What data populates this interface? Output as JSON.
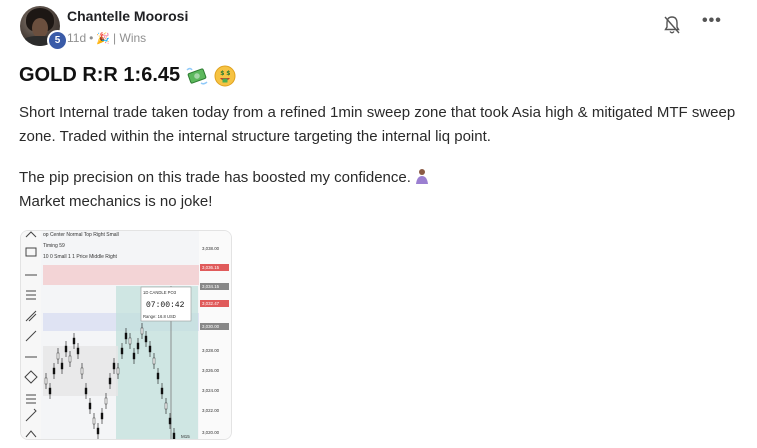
{
  "post": {
    "author": "Chantelle Moorosi",
    "level": "5",
    "time_ago": "11d",
    "separator": "•",
    "category": "| Wins",
    "title": "GOLD R:R 1:6.45",
    "title_emojis": [
      "money-with-wings-icon",
      "money-mouth-face-icon"
    ],
    "paragraph1": "Short Internal trade taken today from a refined 1min sweep zone that took Asia high & mitigated MTF sweep zone. Traded within the internal structure targeting the internal liq point.",
    "paragraph2_line1": "The pip precision on this trade has boosted my confidence.",
    "paragraph2_emoji": "person-icon",
    "paragraph2_line2": "Market mechanics is no joke!"
  },
  "chart_shot": {
    "header_lines": [
      "op Center Normal Top Right Small",
      "Timing 59",
      "10 0 Small 1 1 Price Middle Right"
    ],
    "price_ticks": [
      "3,038.00",
      "3,036.15",
      "3,034.15",
      "3,032.47",
      "3,030.00",
      "3,028.00",
      "3,026.00",
      "3,024.00",
      "3,022.00",
      "3,020.00"
    ],
    "candle_box_title": "1D CANDLE PO3",
    "countdown": "07:00:42",
    "range_label": "Range: 16.8 USD",
    "corner_label": "M15"
  }
}
